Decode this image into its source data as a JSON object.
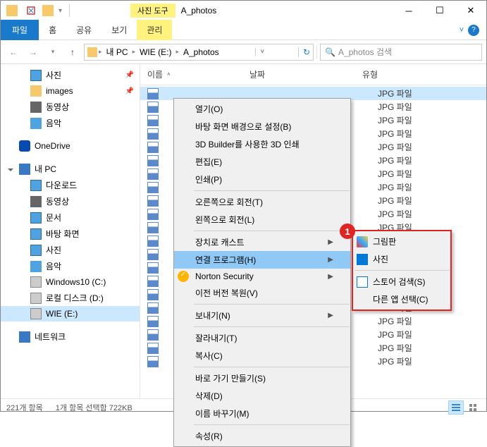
{
  "titlebar": {
    "contextual_tab": "사진 도구",
    "window_title": "A_photos"
  },
  "ribbon": {
    "file": "파일",
    "tabs": [
      "홈",
      "공유",
      "보기"
    ],
    "contextual": "관리"
  },
  "breadcrumb": {
    "segments": [
      "내 PC",
      "WIE (E:)",
      "A_photos"
    ]
  },
  "search": {
    "placeholder": "A_photos 검색"
  },
  "sidebar": {
    "items": [
      {
        "label": "사진",
        "icon": "photo",
        "child": true,
        "pin": true
      },
      {
        "label": "images",
        "icon": "folder",
        "child": true,
        "pin": true
      },
      {
        "label": "동영상",
        "icon": "video",
        "child": true
      },
      {
        "label": "음악",
        "icon": "music",
        "child": true
      },
      {
        "spacer": true
      },
      {
        "label": "OneDrive",
        "icon": "onedrive"
      },
      {
        "spacer": true
      },
      {
        "label": "내 PC",
        "icon": "pc",
        "expanded": true
      },
      {
        "label": "다운로드",
        "icon": "download",
        "child": true
      },
      {
        "label": "동영상",
        "icon": "video",
        "child": true
      },
      {
        "label": "문서",
        "icon": "doc",
        "child": true
      },
      {
        "label": "바탕 화면",
        "icon": "desktop",
        "child": true
      },
      {
        "label": "사진",
        "icon": "photo",
        "child": true
      },
      {
        "label": "음악",
        "icon": "music",
        "child": true
      },
      {
        "label": "Windows10 (C:)",
        "icon": "drive-c",
        "child": true
      },
      {
        "label": "로컬 디스크 (D:)",
        "icon": "drive",
        "child": true
      },
      {
        "label": "WIE (E:)",
        "icon": "drive",
        "child": true,
        "selected": true
      },
      {
        "spacer": true
      },
      {
        "label": "네트워크",
        "icon": "network"
      }
    ]
  },
  "columns": {
    "name": "이름",
    "date": "날짜",
    "type": "유형"
  },
  "files": {
    "rows": 21,
    "type_label": "JPG 파일"
  },
  "context_menu": {
    "items": [
      {
        "label": "열기(O)"
      },
      {
        "label": "바탕 화면 배경으로 설정(B)"
      },
      {
        "label": "3D Builder를 사용한 3D 인쇄"
      },
      {
        "label": "편집(E)"
      },
      {
        "label": "인쇄(P)"
      },
      {
        "sep": true
      },
      {
        "label": "오른쪽으로 회전(T)"
      },
      {
        "label": "왼쪽으로 회전(L)"
      },
      {
        "sep": true
      },
      {
        "label": "장치로 캐스트",
        "submenu": true
      },
      {
        "label": "연결 프로그램(H)",
        "submenu": true,
        "highlighted": true
      },
      {
        "label": "Norton Security",
        "submenu": true,
        "icon": "norton"
      },
      {
        "label": "이전 버전 복원(V)"
      },
      {
        "sep": true
      },
      {
        "label": "보내기(N)",
        "submenu": true
      },
      {
        "sep": true
      },
      {
        "label": "잘라내기(T)"
      },
      {
        "label": "복사(C)"
      },
      {
        "sep": true
      },
      {
        "label": "바로 가기 만들기(S)"
      },
      {
        "label": "삭제(D)"
      },
      {
        "label": "이름 바꾸기(M)"
      },
      {
        "sep": true
      },
      {
        "label": "속성(R)"
      }
    ],
    "submenu": [
      {
        "label": "그림판",
        "icon": "paint"
      },
      {
        "label": "사진",
        "icon": "photos"
      },
      {
        "sep": true
      },
      {
        "label": "스토어 검색(S)",
        "icon": "store"
      },
      {
        "label": "다른 앱 선택(C)"
      }
    ]
  },
  "statusbar": {
    "count": "221개 항목",
    "selected": "1개 항목 선택함 722KB"
  },
  "badge": "1"
}
